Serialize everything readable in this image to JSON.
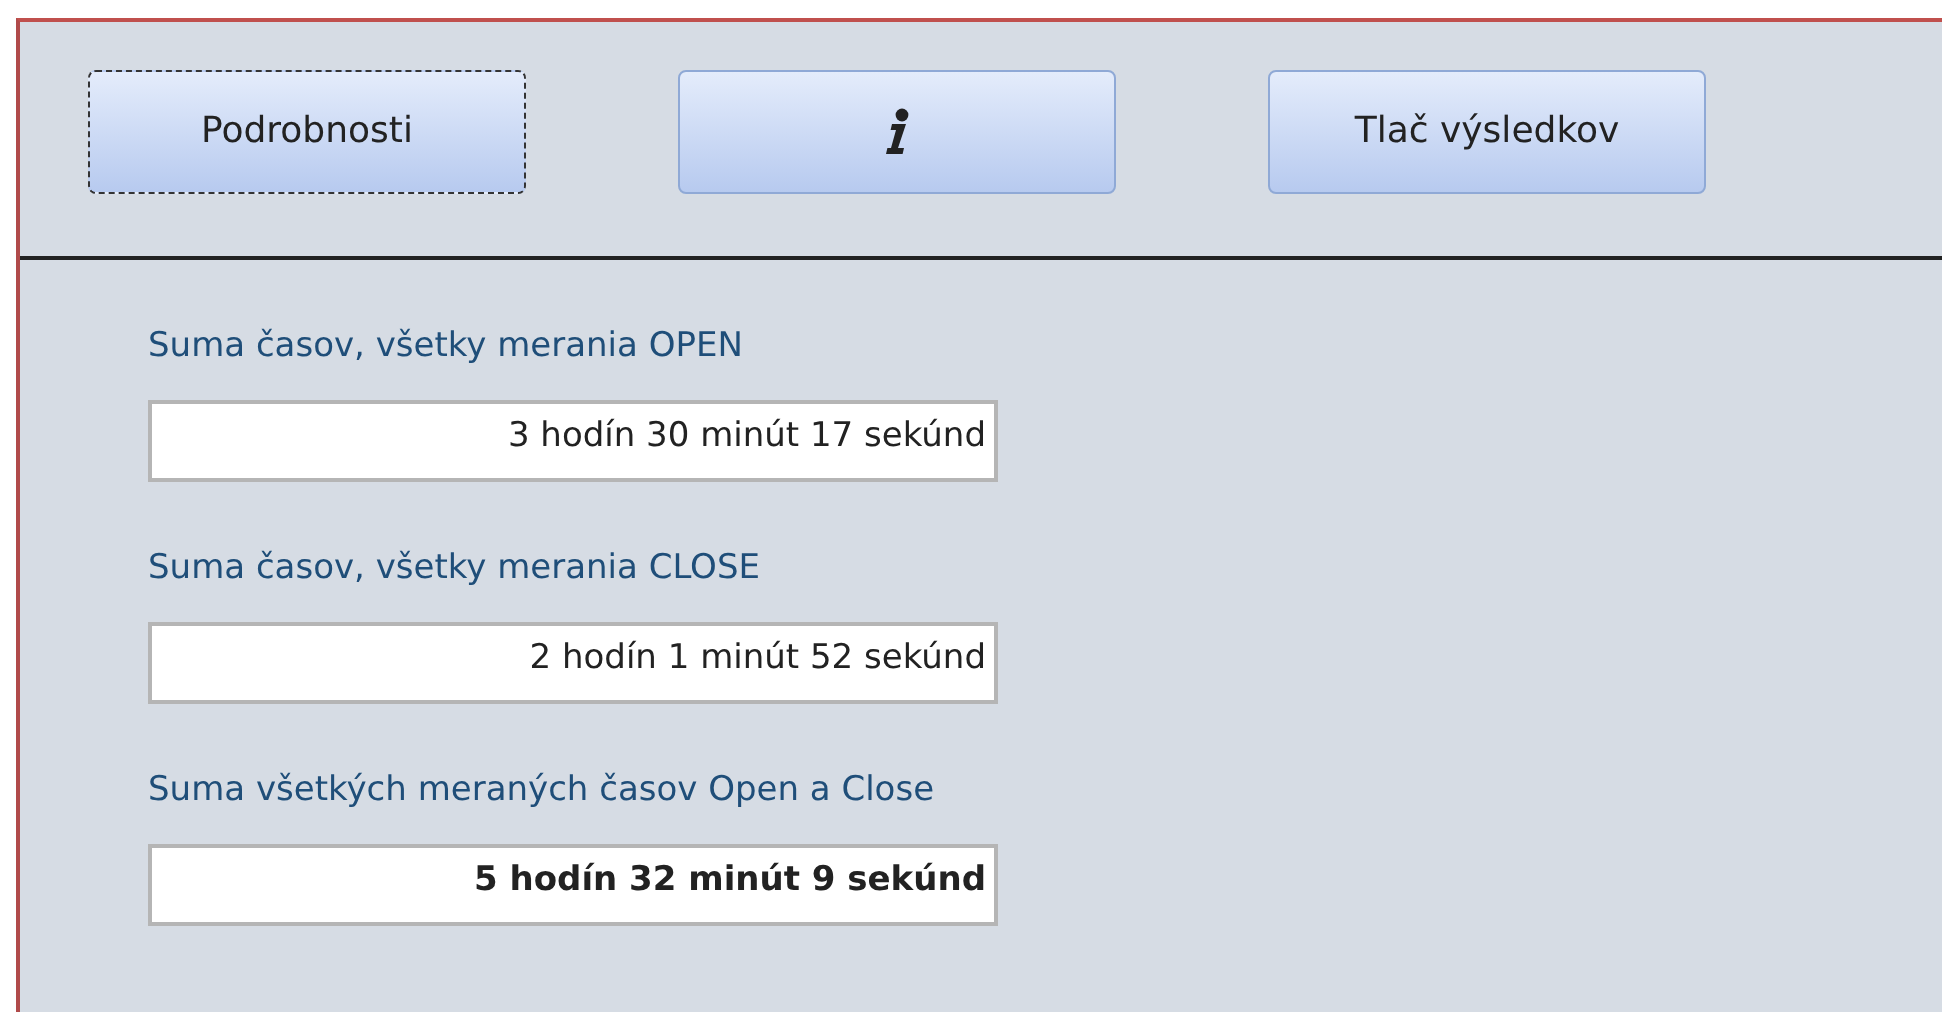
{
  "buttons": [
    {
      "kind": "text",
      "label": "Podrobnosti",
      "focused": true
    },
    {
      "kind": "info",
      "focused": false
    },
    {
      "kind": "text",
      "label": "Tlač výsledkov",
      "focused": false
    }
  ],
  "sums": [
    {
      "label": "Suma časov, všetky merania OPEN",
      "value": "3 hodín 30 minút 17 sekúnd",
      "bold": false
    },
    {
      "label": "Suma časov, všetky merania CLOSE",
      "value": "2 hodín 1 minút 52 sekúnd",
      "bold": false
    },
    {
      "label": "Suma všetkých meraných časov Open a Close",
      "value": "5 hodín 32 minút 9 sekúnd",
      "bold": true
    }
  ]
}
